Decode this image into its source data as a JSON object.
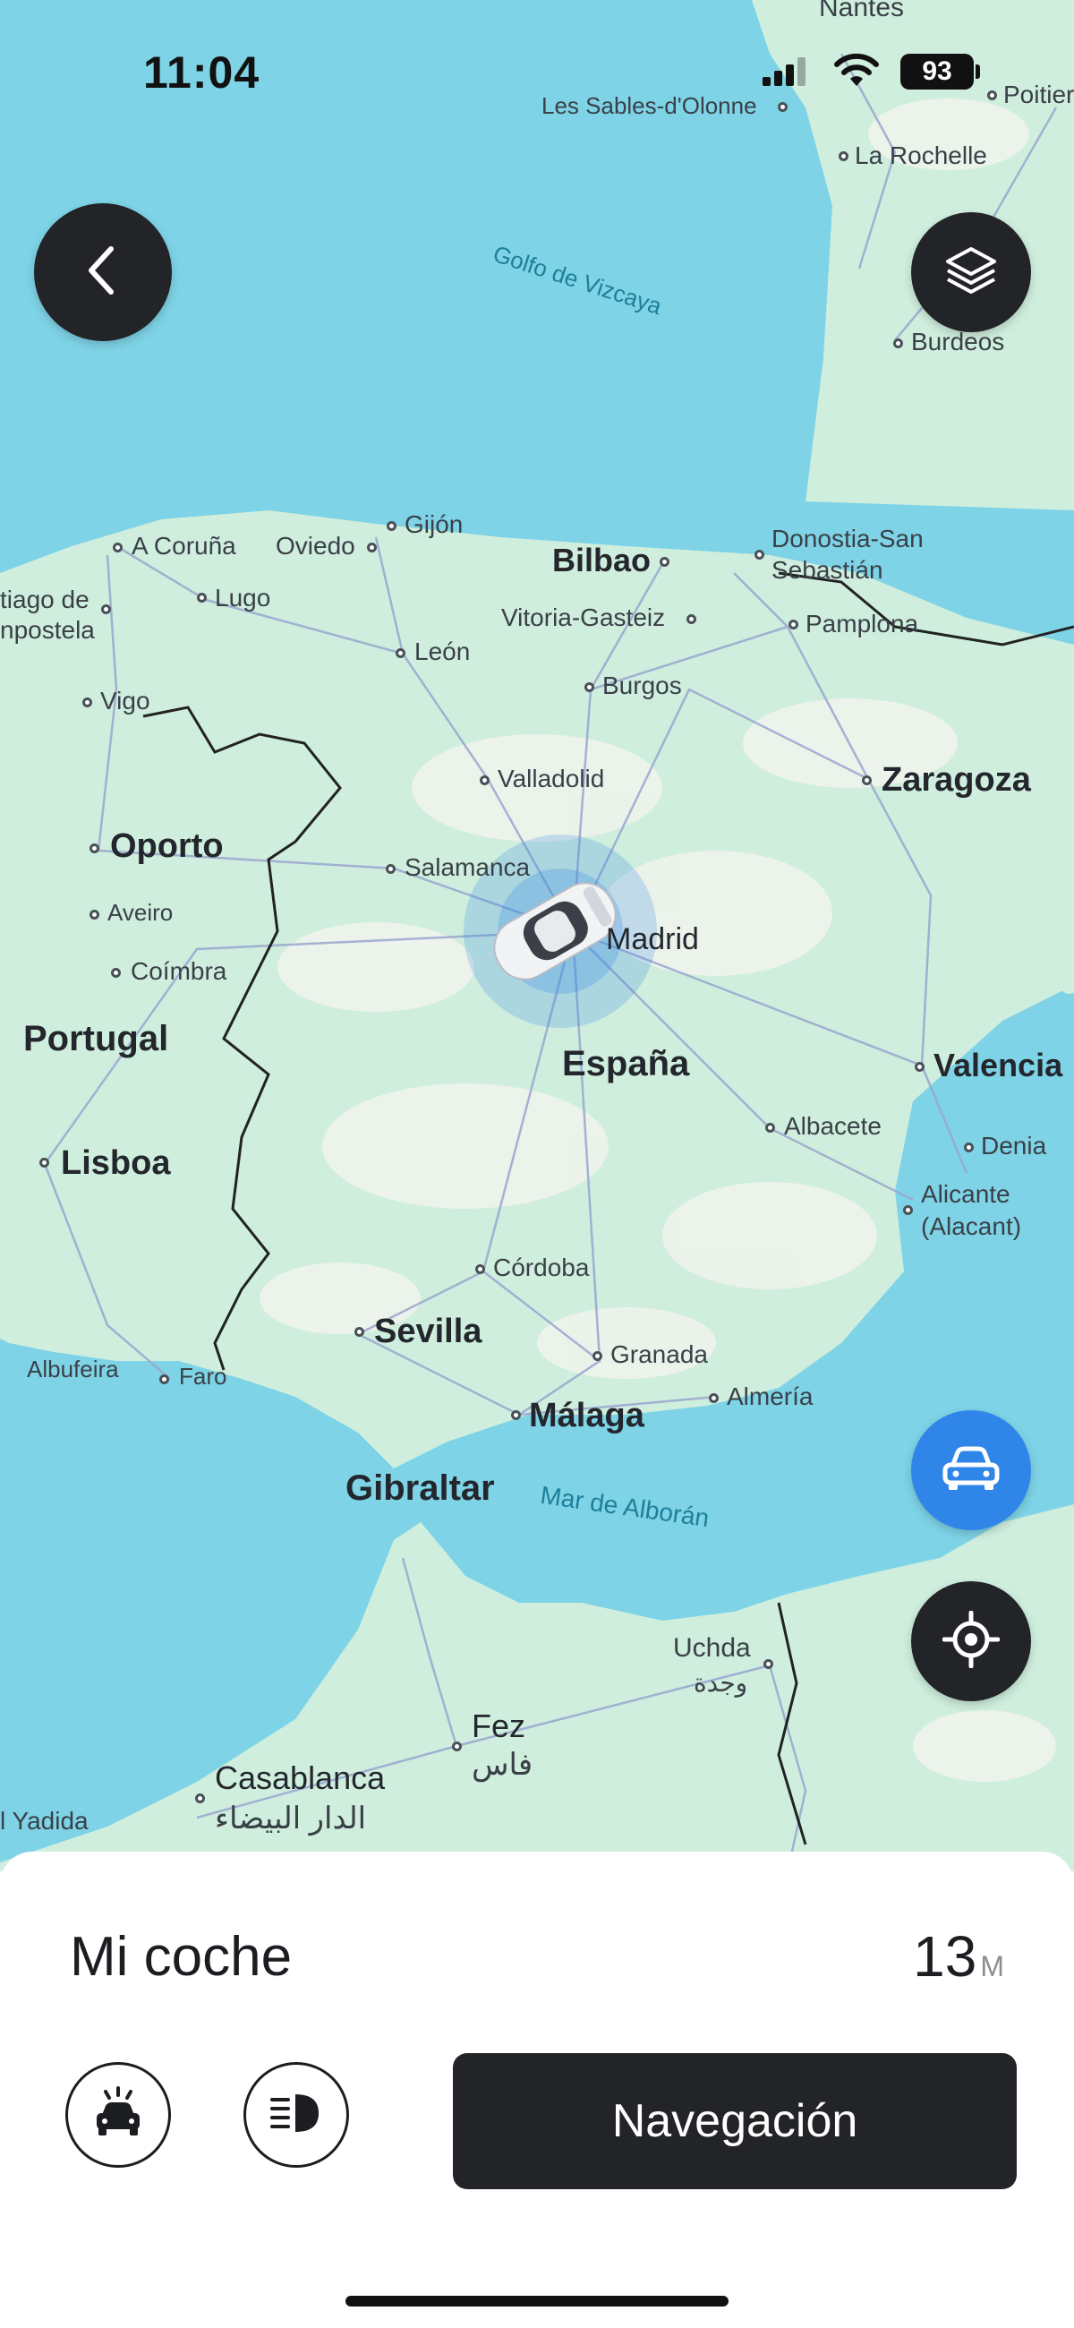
{
  "status_bar": {
    "time": "11:04",
    "battery": "93"
  },
  "map": {
    "labels": {
      "nantes": "Nantes",
      "sables": "Les Sables-d'Olonne",
      "poitiers": "Poitier",
      "la_rochelle": "La Rochelle",
      "golfo": "Golfo de Vizcaya",
      "burdeos": "Burdeos",
      "gijon": "Gijón",
      "a_coruna": "A Coruña",
      "oviedo": "Oviedo",
      "bilbao": "Bilbao",
      "donostia": "Donostia-San",
      "sebastian": "Sebastián",
      "santiago1": "tiago de",
      "santiago2": "npostela",
      "lugo": "Lugo",
      "vitoria": "Vitoria-Gasteiz",
      "pamplona": "Pamplona",
      "leon": "León",
      "vigo": "Vigo",
      "burgos": "Burgos",
      "valladolid": "Valladolid",
      "zaragoza": "Zaragoza",
      "oporto": "Oporto",
      "salamanca": "Salamanca",
      "aveiro": "Aveiro",
      "madrid": "Madrid",
      "coimbra": "Coímbra",
      "portugal": "Portugal",
      "espana": "España",
      "valencia": "Valencia",
      "albacete": "Albacete",
      "lisboa": "Lisboa",
      "denia": "Denia",
      "alicante1": "Alicante",
      "alicante2": "(Alacant)",
      "cordoba": "Córdoba",
      "sevilla": "Sevilla",
      "albufeira": "Albufeira",
      "faro": "Faro",
      "granada": "Granada",
      "almeria": "Almería",
      "malaga": "Málaga",
      "gibraltar": "Gibraltar",
      "mar_alboran": "Mar de Alborán",
      "uchda": "Uchda",
      "uchda_ar": "وجدة",
      "fez": "Fez",
      "fez_ar": "فاس",
      "casablanca": "Casablanca",
      "casablanca_ar": "الدار البيضاء",
      "yadida": "l Yadida"
    },
    "colors": {
      "water": "#7ed3e6",
      "land": "#cfeedd",
      "road": "#9aa6d0",
      "border": "#222222",
      "accent_blue": "#2f86e8"
    },
    "icons": {
      "back": "chevron-left-icon",
      "layers": "layers-icon",
      "car_locate": "car-icon",
      "my_location": "crosshair-icon",
      "car_marker": "car-marker-icon"
    }
  },
  "vehicle": {
    "name": "Mi coche",
    "distance_value": "13",
    "distance_unit": "M"
  },
  "actions": {
    "horn_icon": "car-flash-icon",
    "lights_icon": "headlight-icon",
    "navigate_label": "Navegación"
  }
}
